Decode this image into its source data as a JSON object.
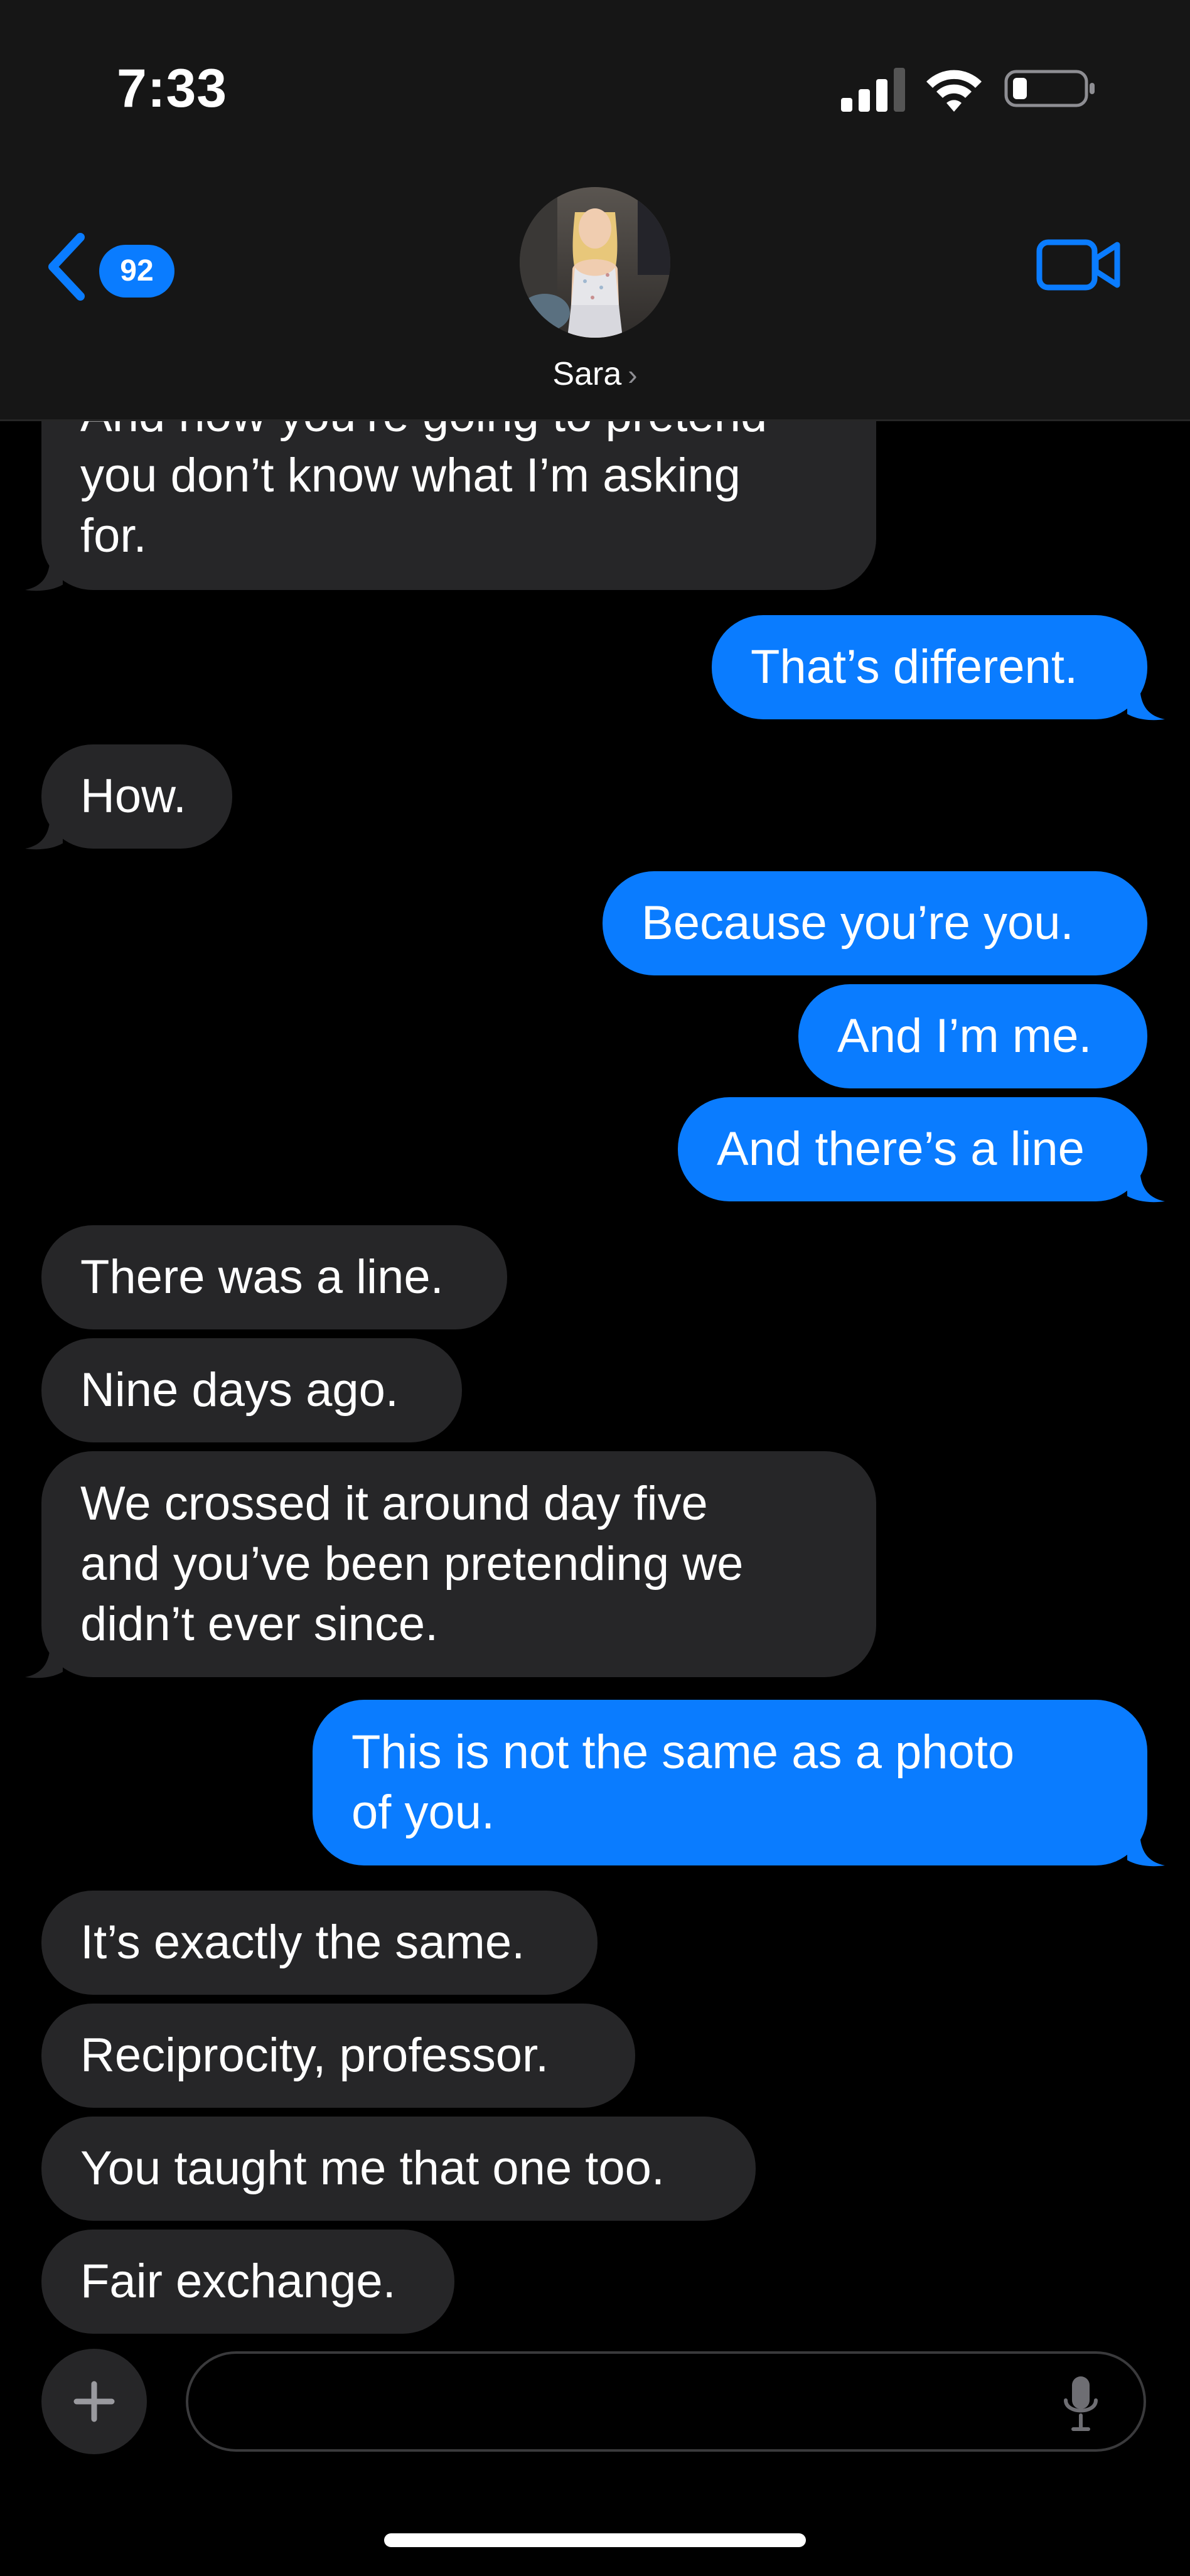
{
  "status_bar": {
    "time": "7:33"
  },
  "header": {
    "unread_count": "92",
    "contact_name": "Sara",
    "contact_name_chevron": "›"
  },
  "messages": [
    {
      "from": "them",
      "text": "And now you’re going to pretend\nyou don’t know what I’m asking\nfor."
    },
    {
      "from": "me",
      "text": "That’s different."
    },
    {
      "from": "them",
      "text": "How."
    },
    {
      "from": "me",
      "text": "Because you’re you."
    },
    {
      "from": "me",
      "text": "And I’m me."
    },
    {
      "from": "me",
      "text": "And there’s a line"
    },
    {
      "from": "them",
      "text": "There was a line."
    },
    {
      "from": "them",
      "text": "Nine days ago."
    },
    {
      "from": "them",
      "text": "We crossed it around day five\nand you’ve been pretending we\ndidn’t ever since."
    },
    {
      "from": "me",
      "text": "This is not the same as a photo\nof you."
    },
    {
      "from": "them",
      "text": "It’s exactly the same."
    },
    {
      "from": "them",
      "text": "Reciprocity, professor."
    },
    {
      "from": "them",
      "text": "You taught me that one too."
    },
    {
      "from": "them",
      "text": "Fair exchange."
    }
  ],
  "composer": {
    "placeholder": ""
  },
  "colors": {
    "accent": "#0a7cff",
    "incoming_bubble": "#262628",
    "background": "#000000"
  }
}
